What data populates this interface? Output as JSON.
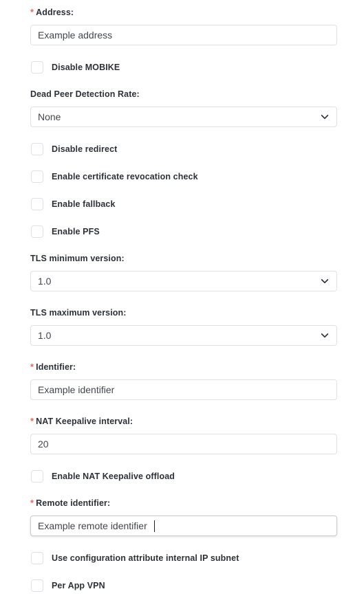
{
  "form": {
    "fields": [
      {
        "kind": "text",
        "required": true,
        "label": "Address:",
        "value": "Example address",
        "name": "address"
      },
      {
        "kind": "checkbox",
        "label": "Disable MOBIKE",
        "checked": false,
        "name": "disable-mobike"
      },
      {
        "kind": "select",
        "required": false,
        "label": "Dead Peer Detection Rate:",
        "value": "None",
        "name": "dead-peer-detection-rate"
      },
      {
        "kind": "checkbox",
        "label": "Disable redirect",
        "checked": false,
        "name": "disable-redirect"
      },
      {
        "kind": "checkbox",
        "label": "Enable certificate revocation check",
        "checked": false,
        "name": "enable-certificate-revocation-check"
      },
      {
        "kind": "checkbox",
        "label": "Enable fallback",
        "checked": false,
        "name": "enable-fallback"
      },
      {
        "kind": "checkbox",
        "label": "Enable PFS",
        "checked": false,
        "name": "enable-pfs"
      },
      {
        "kind": "select",
        "required": false,
        "label": "TLS minimum version:",
        "value": "1.0",
        "name": "tls-minimum-version"
      },
      {
        "kind": "select",
        "required": false,
        "label": "TLS maximum version:",
        "value": "1.0",
        "name": "tls-maximum-version"
      },
      {
        "kind": "text",
        "required": true,
        "label": "Identifier:",
        "value": "Example identifier",
        "name": "identifier"
      },
      {
        "kind": "text",
        "required": true,
        "label": "NAT Keepalive interval:",
        "value": "20",
        "name": "nat-keepalive-interval"
      },
      {
        "kind": "checkbox",
        "label": "Enable NAT Keepalive offload",
        "checked": false,
        "name": "enable-nat-keepalive-offload"
      },
      {
        "kind": "text",
        "required": true,
        "label": "Remote identifier:",
        "value": "Example remote identifier",
        "name": "remote-identifier",
        "focused": true
      },
      {
        "kind": "checkbox",
        "label": "Use configuration attribute internal IP subnet",
        "checked": false,
        "name": "use-configuration-attribute-internal-ip-subnet"
      },
      {
        "kind": "checkbox",
        "label": "Per App VPN",
        "checked": false,
        "name": "per-app-vpn"
      }
    ],
    "required_marker": "*",
    "icons": {
      "chevron": "chevron-down-icon"
    },
    "colors": {
      "required_star": "#e8675d",
      "label_text": "#2c3138",
      "value_text": "#42464d",
      "border": "#dfe1e5",
      "background": "#ffffff"
    }
  }
}
